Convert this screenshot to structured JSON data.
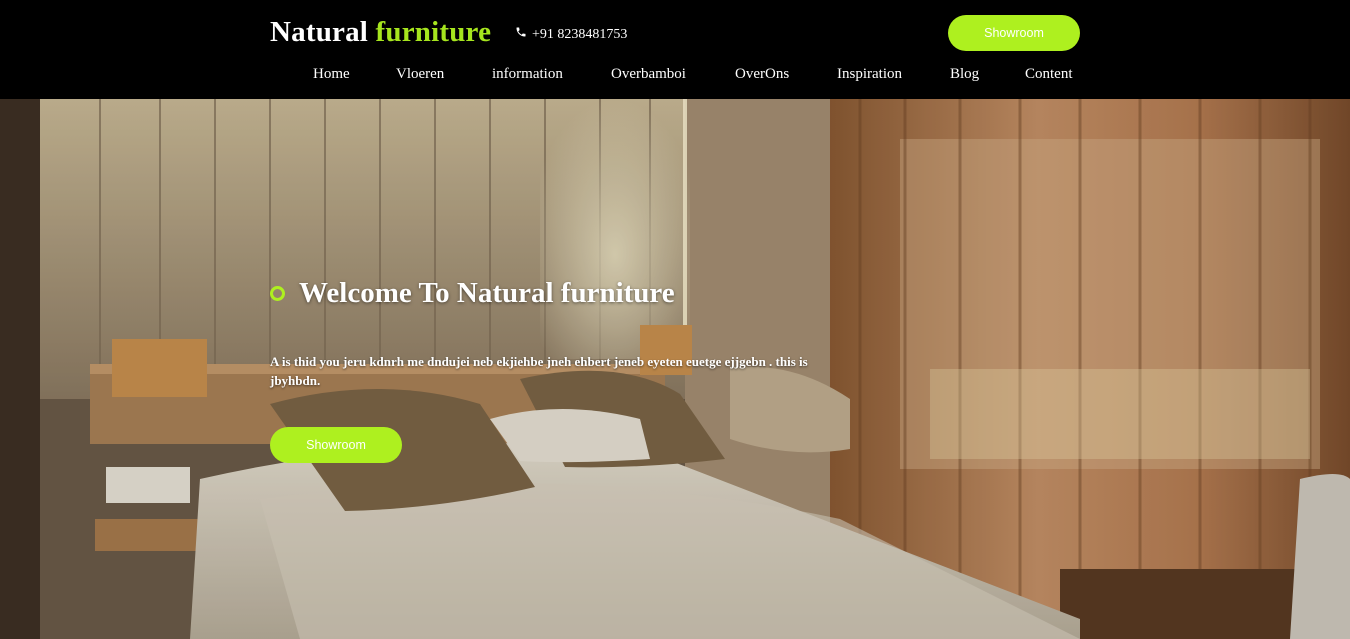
{
  "header": {
    "logo_main": "Natural",
    "logo_accent": "furniture",
    "phone": "+91 8238481753",
    "cta_label": "Showroom"
  },
  "nav": {
    "items": [
      "Home",
      "Vloeren",
      "information",
      "Overbamboi",
      "OverOns",
      "Inspiration",
      "Blog",
      "Content"
    ]
  },
  "hero": {
    "title": "Welcome To Natural furniture",
    "description": "A is thid you jeru kdnrh me dndujei neb ekjiehbe jneh ehbert jeneb eyeten euetge ejjgebn . this is jbyhbdn.",
    "cta_label": "Showroom"
  },
  "colors": {
    "accent": "#aef01f",
    "header_bg": "#000000"
  },
  "icons": {
    "phone": "phone-icon"
  }
}
